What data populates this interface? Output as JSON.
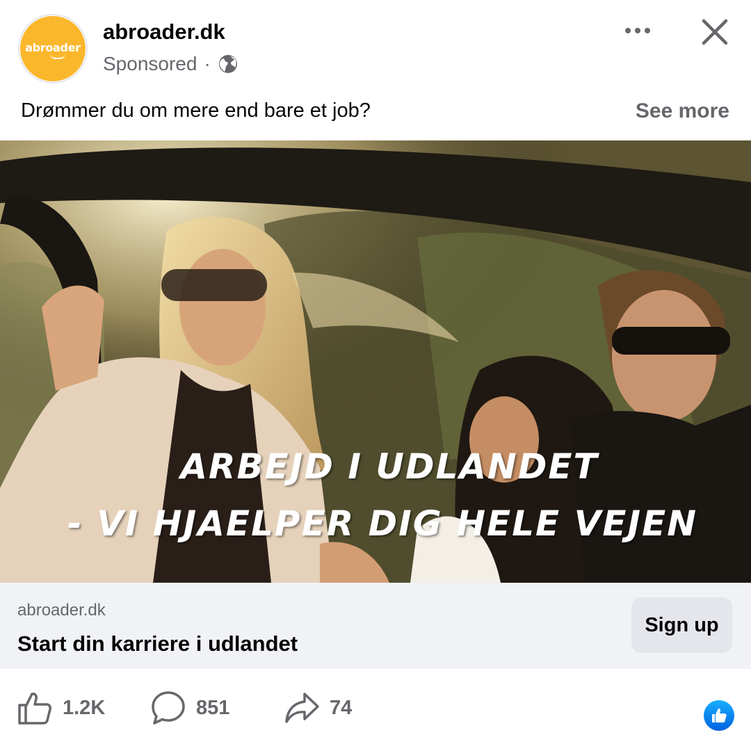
{
  "post": {
    "page_name": "abroader.dk",
    "avatar_text": "abroader",
    "sponsored_label": "Sponsored",
    "separator": "·",
    "caption": "Drømmer du om mere end bare et job?",
    "see_more_label": "See more"
  },
  "image": {
    "headline_line1": "ARBEJD I UDLANDET",
    "headline_line2": "- VI HJAELPER DIG HELE VEJEN"
  },
  "link": {
    "domain": "abroader.dk",
    "title": "Start din karriere i udlandet",
    "cta_label": "Sign up"
  },
  "engagement": {
    "likes": "1.2K",
    "comments": "851",
    "shares": "74"
  },
  "icons": {
    "more": "more-horizontal-icon",
    "close": "close-icon",
    "privacy": "globe-icon",
    "like": "thumbs-up-icon",
    "comment": "comment-bubble-icon",
    "share": "share-arrow-icon",
    "reaction": "like-reaction-icon"
  },
  "colors": {
    "brand_yellow": "#fbb72c",
    "secondary_text": "#65676b",
    "link_bar_bg": "#f0f2f5",
    "button_bg": "#e4e6eb",
    "reaction_blue": "#1877f2"
  }
}
